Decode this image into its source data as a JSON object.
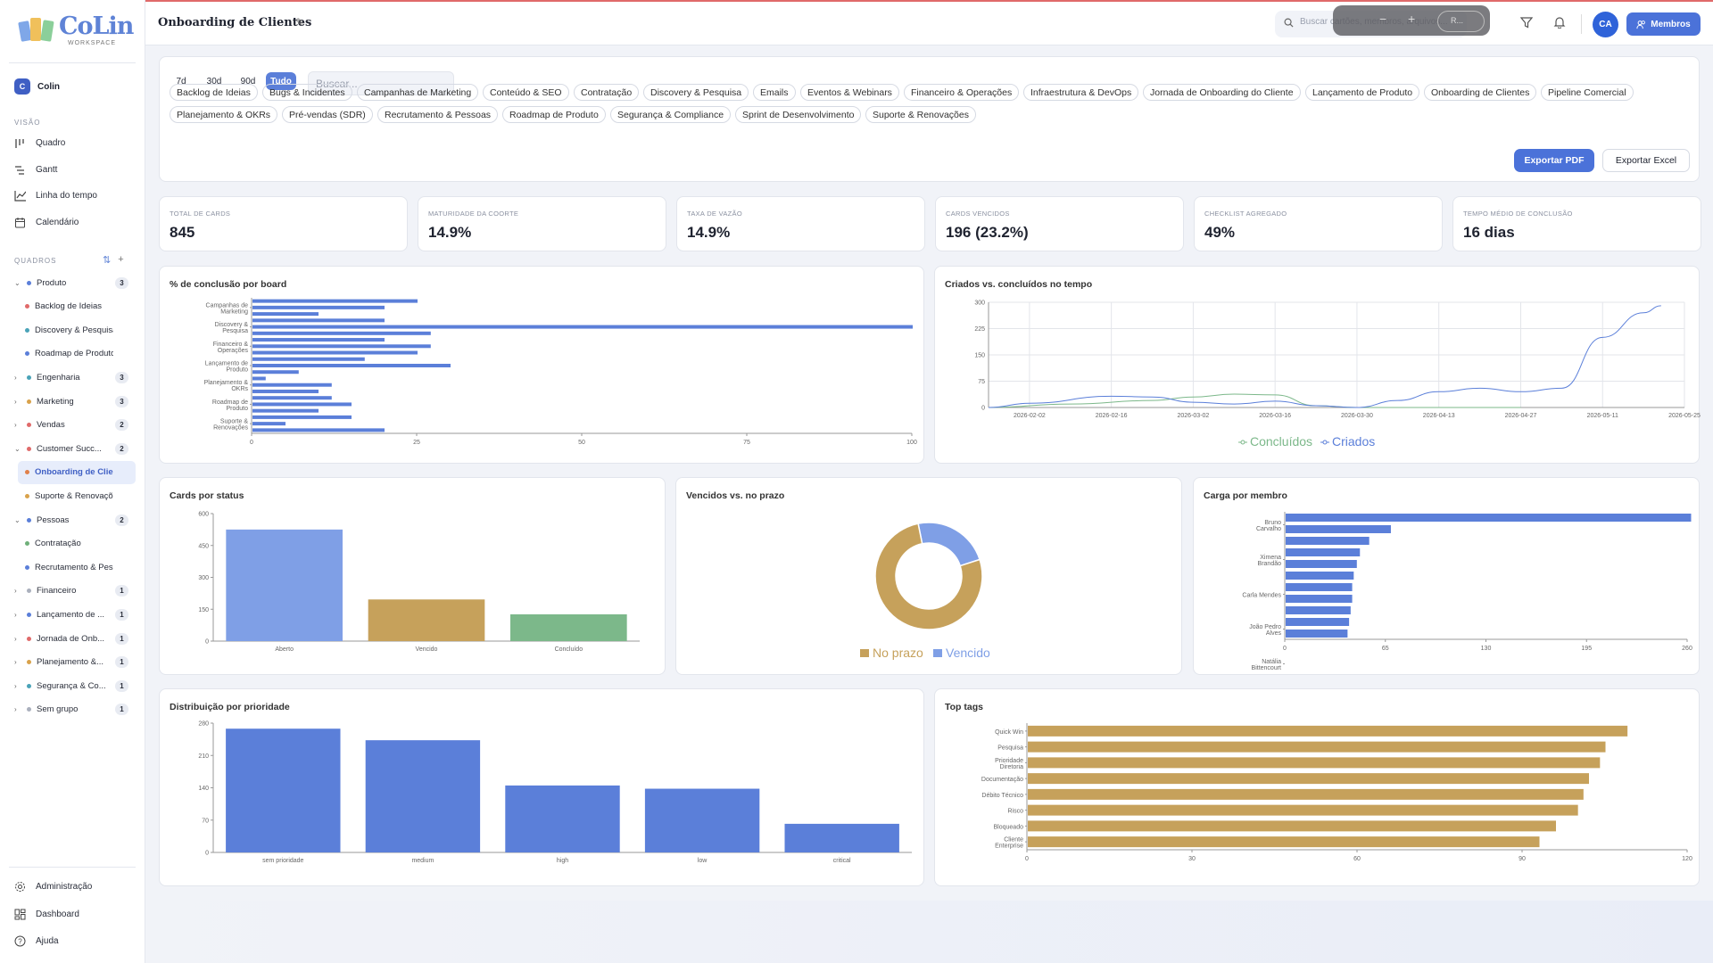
{
  "app": {
    "logo_text": "CoLin",
    "logo_sub": "WORKSPACE"
  },
  "workspace": {
    "initial": "C",
    "name": "Colin"
  },
  "sidebar": {
    "visao_label": "VISÃO",
    "nav": [
      {
        "label": "Quadro",
        "icon": "board-icon"
      },
      {
        "label": "Gantt",
        "icon": "gantt-icon"
      },
      {
        "label": "Linha do tempo",
        "icon": "timeline-icon"
      },
      {
        "label": "Calendário",
        "icon": "calendar-icon"
      }
    ],
    "quadros_label": "QUADROS",
    "tree": [
      {
        "label": "Produto",
        "color": "#5b7fd9",
        "count": "3",
        "type": "group",
        "open": true
      },
      {
        "label": "Backlog de Ideias",
        "color": "#e06a6a",
        "type": "sub"
      },
      {
        "label": "Discovery & Pesquisa",
        "color": "#4aa3b8",
        "type": "sub"
      },
      {
        "label": "Roadmap de Produto",
        "color": "#5b7fd9",
        "type": "sub"
      },
      {
        "label": "Engenharia",
        "color": "#4aa3b8",
        "count": "3",
        "type": "group"
      },
      {
        "label": "Marketing",
        "color": "#d9a24b",
        "count": "3",
        "type": "group"
      },
      {
        "label": "Vendas",
        "color": "#e06a6a",
        "count": "2",
        "type": "group"
      },
      {
        "label": "Customer Succ...",
        "color": "#e06a6a",
        "count": "2",
        "type": "group",
        "open": true
      },
      {
        "label": "Onboarding de Clien...",
        "color": "#e0804a",
        "type": "active"
      },
      {
        "label": "Suporte & Renovações",
        "color": "#d9a24b",
        "type": "sub"
      },
      {
        "label": "Pessoas",
        "color": "#5b7fd9",
        "count": "2",
        "type": "group",
        "open": true
      },
      {
        "label": "Contratação",
        "color": "#6fb07a",
        "type": "sub"
      },
      {
        "label": "Recrutamento & Pes...",
        "color": "#5b7fd9",
        "type": "sub"
      },
      {
        "label": "Financeiro",
        "color": "#aab0bd",
        "count": "1",
        "type": "group"
      },
      {
        "label": "Lançamento de ...",
        "color": "#5b7fd9",
        "count": "1",
        "type": "group"
      },
      {
        "label": "Jornada de Onb...",
        "color": "#e06a6a",
        "count": "1",
        "type": "group"
      },
      {
        "label": "Planejamento &...",
        "color": "#d9a24b",
        "count": "1",
        "type": "group"
      },
      {
        "label": "Segurança & Co...",
        "color": "#4aa3b8",
        "count": "1",
        "type": "group"
      },
      {
        "label": "Sem grupo",
        "color": "#aab0bd",
        "count": "1",
        "type": "group"
      }
    ],
    "bottom": [
      {
        "label": "Administração",
        "icon": "gear-icon"
      },
      {
        "label": "Dashboard",
        "icon": "dashboard-icon"
      },
      {
        "label": "Ajuda",
        "icon": "help-icon"
      }
    ]
  },
  "header": {
    "title": "Onboarding de Clientes",
    "search_placeholder": "Buscar cartões, membros, arquivos...",
    "zoom_reset": "R...",
    "avatar": "CA",
    "members_label": "Membros"
  },
  "filters": {
    "ranges": [
      "7d",
      "30d",
      "90d",
      "Tudo"
    ],
    "active_range": "Tudo",
    "search_placeholder": "Buscar...",
    "chips_row1": [
      "Backlog de Ideias",
      "Bugs & Incidentes",
      "Campanhas de Marketing",
      "Conteúdo & SEO",
      "Contratação",
      "Discovery & Pesquisa",
      "Emails",
      "Eventos & Webinars",
      "Financeiro & Operações",
      "Infraestrutura & DevOps",
      "Jornada de Onboarding do Cliente",
      "Lançamento de Produto",
      "Onboarding de Clientes",
      "Pipeline Comercial"
    ],
    "chips_row2": [
      "Planejamento & OKRs",
      "Pré-vendas (SDR)",
      "Recrutamento & Pessoas",
      "Roadmap de Produto",
      "Segurança & Compliance",
      "Sprint de Desenvolvimento",
      "Suporte & Renovações"
    ],
    "export_pdf": "Exportar PDF",
    "export_excel": "Exportar Excel"
  },
  "kpis": [
    {
      "label": "TOTAL DE CARDS",
      "value": "845"
    },
    {
      "label": "MATURIDADE DA COORTE",
      "value": "14.9%"
    },
    {
      "label": "TAXA DE VAZÃO",
      "value": "14.9%"
    },
    {
      "label": "CARDS VENCIDOS",
      "value": "196 (23.2%)"
    },
    {
      "label": "CHECKLIST AGREGADO",
      "value": "49%"
    },
    {
      "label": "TEMPO MÉDIO DE CONCLUSÃO",
      "value": "16 dias"
    }
  ],
  "charts": {
    "c1_title": "% de conclusão por board",
    "c2_title": "Criados vs. concluídos no tempo",
    "c3_title": "Cards por status",
    "c4_title": "Vencidos vs. no prazo",
    "c5_title": "Carga por membro",
    "c6_title": "Distribuição por prioridade",
    "c7_title": "Top tags"
  },
  "chart_data": [
    {
      "type": "bar",
      "orientation": "horizontal",
      "title": "% de conclusão por board",
      "xlim": [
        0,
        100
      ],
      "xticks": [
        0,
        25,
        50,
        75,
        100
      ],
      "color": "#5b7fd9",
      "tick_labels": [
        "Campanhas de Marketing",
        "Discovery & Pesquisa",
        "Financeiro & Operações",
        "Lançamento de Produto",
        "Planejamento & OKRs",
        "Roadmap de Produto",
        "Suporte & Renovações"
      ],
      "values": [
        25,
        20,
        10,
        20,
        100,
        27,
        20,
        27,
        25,
        17,
        30,
        7,
        2,
        12,
        10,
        12,
        15,
        10,
        15,
        5,
        20
      ]
    },
    {
      "type": "line",
      "title": "Criados vs. concluídos no tempo",
      "ylim": [
        0,
        300
      ],
      "yticks": [
        0,
        75,
        150,
        225,
        300
      ],
      "x_ticks": [
        "2026-02-02",
        "2026-02-16",
        "2026-03-02",
        "2026-03-16",
        "2026-03-30",
        "2026-04-13",
        "2026-04-27",
        "2026-05-11",
        "2026-05-25"
      ],
      "series": [
        {
          "name": "Concluídos",
          "color": "#7cb88a",
          "x": [
            "2026-01-26",
            "2026-02-09",
            "2026-02-23",
            "2026-03-02",
            "2026-03-09",
            "2026-03-16",
            "2026-03-23",
            "2026-03-30",
            "2026-04-06",
            "2026-04-13",
            "2026-04-20",
            "2026-04-27"
          ],
          "y": [
            0,
            10,
            20,
            30,
            38,
            36,
            5,
            0,
            0,
            0,
            0,
            0
          ]
        },
        {
          "name": "Criados",
          "color": "#5b7fd9",
          "x": [
            "2026-01-26",
            "2026-02-02",
            "2026-02-16",
            "2026-02-23",
            "2026-03-02",
            "2026-03-09",
            "2026-03-16",
            "2026-03-23",
            "2026-03-30",
            "2026-04-06",
            "2026-04-13",
            "2026-04-20",
            "2026-04-27",
            "2026-05-04",
            "2026-05-11",
            "2026-05-18",
            "2026-05-21"
          ],
          "y": [
            0,
            12,
            32,
            30,
            15,
            10,
            18,
            5,
            0,
            20,
            45,
            55,
            45,
            55,
            200,
            270,
            290
          ]
        }
      ]
    },
    {
      "type": "bar",
      "title": "Cards por status",
      "categories": [
        "Aberto",
        "Vencido",
        "Concluído"
      ],
      "values": [
        525,
        196,
        126
      ],
      "colors": [
        "#7f9fe6",
        "#c6a15b",
        "#7cb88a"
      ],
      "ylim": [
        0,
        600
      ],
      "yticks": [
        0,
        150,
        300,
        450,
        600
      ]
    },
    {
      "type": "pie",
      "title": "Vencidos vs. no prazo",
      "donut": true,
      "labels": [
        "No prazo",
        "Vencido"
      ],
      "values": [
        649,
        196
      ],
      "colors": [
        "#c6a15b",
        "#7f9fe6"
      ]
    },
    {
      "type": "bar",
      "orientation": "horizontal",
      "title": "Carga por membro",
      "xlim": [
        0,
        260
      ],
      "xticks": [
        0,
        65,
        130,
        195,
        260
      ],
      "color": "#5b7fd9",
      "tick_labels": [
        "Bruno Carvalho",
        "Ximena Brandão",
        "Carla Mendes",
        "João Pedro Alves",
        "Natália Bittencourt"
      ],
      "values": [
        262,
        68,
        54,
        48,
        46,
        44,
        43,
        43,
        42,
        41,
        40
      ]
    },
    {
      "type": "bar",
      "title": "Distribuição por prioridade",
      "categories": [
        "sem prioridade",
        "medium",
        "high",
        "low",
        "critical"
      ],
      "values": [
        268,
        243,
        145,
        138,
        62
      ],
      "color": "#5b7fd9",
      "ylim": [
        0,
        280
      ],
      "yticks": [
        0,
        70,
        140,
        210,
        280
      ]
    },
    {
      "type": "bar",
      "orientation": "horizontal",
      "title": "Top tags",
      "categories": [
        "Quick Win",
        "Pesquisa",
        "Prioridade Diretoria",
        "Documentação",
        "Débito Técnico",
        "Risco",
        "Bloqueado",
        "Cliente Enterprise"
      ],
      "values": [
        109,
        105,
        104,
        102,
        101,
        100,
        96,
        93
      ],
      "color": "#c6a15b",
      "xlim": [
        0,
        120
      ],
      "xticks": [
        0,
        30,
        60,
        90,
        120
      ]
    }
  ]
}
